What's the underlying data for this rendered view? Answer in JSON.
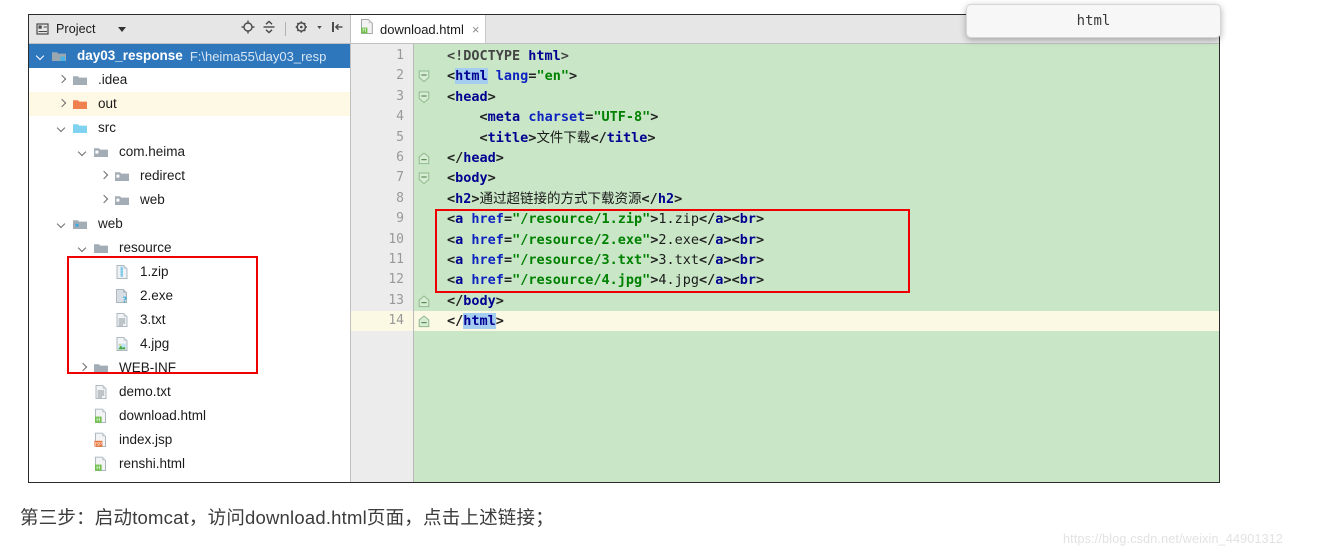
{
  "project_panel": {
    "title": "Project",
    "icons": [
      "project-view-icon",
      "chevron-down-icon",
      "locate-target-icon",
      "collapse-all-icon",
      "settings-gear-icon",
      "hide-panel-icon"
    ],
    "tree": [
      {
        "depth": 0,
        "arrow": "down",
        "icon": "module-folder-icon",
        "label": "day03_response",
        "path": "F:\\heima55\\day03_resp",
        "state": "selected",
        "bold": true
      },
      {
        "depth": 1,
        "arrow": "right",
        "icon": "folder-gray-icon",
        "label": ".idea",
        "path": "",
        "state": "normal",
        "bold": false
      },
      {
        "depth": 1,
        "arrow": "right",
        "icon": "folder-orange-icon",
        "label": "out",
        "path": "",
        "state": "excluded",
        "bold": false
      },
      {
        "depth": 1,
        "arrow": "down",
        "icon": "folder-source-icon",
        "label": "src",
        "path": "",
        "state": "normal",
        "bold": false
      },
      {
        "depth": 2,
        "arrow": "down",
        "icon": "package-icon",
        "label": "com.heima",
        "path": "",
        "state": "normal",
        "bold": false
      },
      {
        "depth": 3,
        "arrow": "right",
        "icon": "package-icon",
        "label": "redirect",
        "path": "",
        "state": "normal",
        "bold": false
      },
      {
        "depth": 3,
        "arrow": "right",
        "icon": "package-icon",
        "label": "web",
        "path": "",
        "state": "normal",
        "bold": false
      },
      {
        "depth": 1,
        "arrow": "down",
        "icon": "folder-web-icon",
        "label": "web",
        "path": "",
        "state": "normal",
        "bold": false
      },
      {
        "depth": 2,
        "arrow": "down",
        "icon": "folder-gray-icon",
        "label": "resource",
        "path": "",
        "state": "normal",
        "bold": false
      },
      {
        "depth": 3,
        "arrow": "none",
        "icon": "zip-file-icon",
        "label": "1.zip",
        "path": "",
        "state": "normal",
        "bold": false
      },
      {
        "depth": 3,
        "arrow": "none",
        "icon": "exe-file-icon",
        "label": "2.exe",
        "path": "",
        "state": "normal",
        "bold": false
      },
      {
        "depth": 3,
        "arrow": "none",
        "icon": "text-file-icon",
        "label": "3.txt",
        "path": "",
        "state": "normal",
        "bold": false
      },
      {
        "depth": 3,
        "arrow": "none",
        "icon": "image-file-icon",
        "label": "4.jpg",
        "path": "",
        "state": "normal",
        "bold": false
      },
      {
        "depth": 2,
        "arrow": "right",
        "icon": "folder-gray-icon",
        "label": "WEB-INF",
        "path": "",
        "state": "normal",
        "bold": false
      },
      {
        "depth": 2,
        "arrow": "none",
        "icon": "text-file-icon",
        "label": "demo.txt",
        "path": "",
        "state": "normal",
        "bold": false
      },
      {
        "depth": 2,
        "arrow": "none",
        "icon": "html-file-icon",
        "label": "download.html",
        "path": "",
        "state": "normal",
        "bold": false
      },
      {
        "depth": 2,
        "arrow": "none",
        "icon": "jsp-file-icon",
        "label": "index.jsp",
        "path": "",
        "state": "normal",
        "bold": false
      },
      {
        "depth": 2,
        "arrow": "none",
        "icon": "html-file-icon",
        "label": "renshi.html",
        "path": "",
        "state": "normal",
        "bold": false
      }
    ]
  },
  "editor": {
    "tab": {
      "label": "download.html",
      "icon": "html-file-icon",
      "close": "×"
    },
    "current_line": 14,
    "lines": [
      {
        "n": "1",
        "indent": 0,
        "fold": "none",
        "tokens": [
          {
            "t": "doc",
            "v": "<!DOCTYPE "
          },
          {
            "t": "tag",
            "v": "html"
          },
          {
            "t": "doc",
            "v": ">"
          }
        ]
      },
      {
        "n": "2",
        "indent": 0,
        "fold": "open",
        "tokens": [
          {
            "t": "punct",
            "v": "<"
          },
          {
            "t": "tag",
            "v": "html",
            "sel": true
          },
          {
            "t": "punct",
            "v": " "
          },
          {
            "t": "attr",
            "v": "lang"
          },
          {
            "t": "punct",
            "v": "="
          },
          {
            "t": "val",
            "v": "\"en\""
          },
          {
            "t": "punct",
            "v": ">"
          }
        ]
      },
      {
        "n": "3",
        "indent": 0,
        "fold": "open",
        "tokens": [
          {
            "t": "punct",
            "v": "<"
          },
          {
            "t": "tag",
            "v": "head"
          },
          {
            "t": "punct",
            "v": ">"
          }
        ]
      },
      {
        "n": "4",
        "indent": 1,
        "fold": "none",
        "tokens": [
          {
            "t": "punct",
            "v": "<"
          },
          {
            "t": "tag",
            "v": "meta"
          },
          {
            "t": "punct",
            "v": " "
          },
          {
            "t": "attr",
            "v": "charset"
          },
          {
            "t": "punct",
            "v": "="
          },
          {
            "t": "val",
            "v": "\"UTF-8\""
          },
          {
            "t": "punct",
            "v": ">"
          }
        ]
      },
      {
        "n": "5",
        "indent": 1,
        "fold": "none",
        "tokens": [
          {
            "t": "punct",
            "v": "<"
          },
          {
            "t": "tag",
            "v": "title"
          },
          {
            "t": "punct",
            "v": ">"
          },
          {
            "t": "text",
            "v": "文件下载"
          },
          {
            "t": "punct",
            "v": "</"
          },
          {
            "t": "tag",
            "v": "title"
          },
          {
            "t": "punct",
            "v": ">"
          }
        ]
      },
      {
        "n": "6",
        "indent": 0,
        "fold": "close",
        "tokens": [
          {
            "t": "punct",
            "v": "</"
          },
          {
            "t": "tag",
            "v": "head"
          },
          {
            "t": "punct",
            "v": ">"
          }
        ]
      },
      {
        "n": "7",
        "indent": 0,
        "fold": "open",
        "tokens": [
          {
            "t": "punct",
            "v": "<"
          },
          {
            "t": "tag",
            "v": "body"
          },
          {
            "t": "punct",
            "v": ">"
          }
        ]
      },
      {
        "n": "8",
        "indent": 0,
        "fold": "none",
        "tokens": [
          {
            "t": "punct",
            "v": "<"
          },
          {
            "t": "tag",
            "v": "h2"
          },
          {
            "t": "punct",
            "v": ">"
          },
          {
            "t": "text",
            "v": "通过超链接的方式下载资源"
          },
          {
            "t": "punct",
            "v": "</"
          },
          {
            "t": "tag",
            "v": "h2"
          },
          {
            "t": "punct",
            "v": ">"
          }
        ]
      },
      {
        "n": "9",
        "indent": 0,
        "fold": "none",
        "tokens": [
          {
            "t": "punct",
            "v": "<"
          },
          {
            "t": "tag",
            "v": "a"
          },
          {
            "t": "punct",
            "v": " "
          },
          {
            "t": "attr",
            "v": "href"
          },
          {
            "t": "punct",
            "v": "="
          },
          {
            "t": "val",
            "v": "\"/resource/1.zip\""
          },
          {
            "t": "punct",
            "v": ">"
          },
          {
            "t": "text",
            "v": "1.zip"
          },
          {
            "t": "punct",
            "v": "</"
          },
          {
            "t": "tag",
            "v": "a"
          },
          {
            "t": "punct",
            "v": "><"
          },
          {
            "t": "tag",
            "v": "br"
          },
          {
            "t": "punct",
            "v": ">"
          }
        ]
      },
      {
        "n": "10",
        "indent": 0,
        "fold": "none",
        "tokens": [
          {
            "t": "punct",
            "v": "<"
          },
          {
            "t": "tag",
            "v": "a"
          },
          {
            "t": "punct",
            "v": " "
          },
          {
            "t": "attr",
            "v": "href"
          },
          {
            "t": "punct",
            "v": "="
          },
          {
            "t": "val",
            "v": "\"/resource/2.exe\""
          },
          {
            "t": "punct",
            "v": ">"
          },
          {
            "t": "text",
            "v": "2.exe"
          },
          {
            "t": "punct",
            "v": "</"
          },
          {
            "t": "tag",
            "v": "a"
          },
          {
            "t": "punct",
            "v": "><"
          },
          {
            "t": "tag",
            "v": "br"
          },
          {
            "t": "punct",
            "v": ">"
          }
        ]
      },
      {
        "n": "11",
        "indent": 0,
        "fold": "none",
        "tokens": [
          {
            "t": "punct",
            "v": "<"
          },
          {
            "t": "tag",
            "v": "a"
          },
          {
            "t": "punct",
            "v": " "
          },
          {
            "t": "attr",
            "v": "href"
          },
          {
            "t": "punct",
            "v": "="
          },
          {
            "t": "val",
            "v": "\"/resource/3.txt\""
          },
          {
            "t": "punct",
            "v": ">"
          },
          {
            "t": "text",
            "v": "3.txt"
          },
          {
            "t": "punct",
            "v": "</"
          },
          {
            "t": "tag",
            "v": "a"
          },
          {
            "t": "punct",
            "v": "><"
          },
          {
            "t": "tag",
            "v": "br"
          },
          {
            "t": "punct",
            "v": ">"
          }
        ]
      },
      {
        "n": "12",
        "indent": 0,
        "fold": "none",
        "tokens": [
          {
            "t": "punct",
            "v": "<"
          },
          {
            "t": "tag",
            "v": "a"
          },
          {
            "t": "punct",
            "v": " "
          },
          {
            "t": "attr",
            "v": "href"
          },
          {
            "t": "punct",
            "v": "="
          },
          {
            "t": "val",
            "v": "\"/resource/4.jpg\""
          },
          {
            "t": "punct",
            "v": ">"
          },
          {
            "t": "text",
            "v": "4.jpg"
          },
          {
            "t": "punct",
            "v": "</"
          },
          {
            "t": "tag",
            "v": "a"
          },
          {
            "t": "punct",
            "v": "><"
          },
          {
            "t": "tag",
            "v": "br"
          },
          {
            "t": "punct",
            "v": ">"
          }
        ]
      },
      {
        "n": "13",
        "indent": 0,
        "fold": "close",
        "tokens": [
          {
            "t": "punct",
            "v": "</"
          },
          {
            "t": "tag",
            "v": "body"
          },
          {
            "t": "punct",
            "v": ">"
          }
        ]
      },
      {
        "n": "14",
        "indent": 0,
        "fold": "close",
        "tokens": [
          {
            "t": "punct",
            "v": "</"
          },
          {
            "t": "tag",
            "v": "html",
            "sel": true
          },
          {
            "t": "punct",
            "v": ">"
          }
        ]
      }
    ]
  },
  "tooltip": {
    "text": "html"
  },
  "annotations": {
    "resource_box": "red-highlight-box-resource-folder",
    "code_box": "red-highlight-box-anchor-lines"
  },
  "caption": "第三步：启动tomcat，访问download.html页面，点击上述链接；",
  "watermark": "https://blog.csdn.net/weixin_44901312",
  "colors": {
    "selection_blue": "#2f77bd",
    "editor_green": "#c9e7c7",
    "current_line": "#fbf8e3",
    "excluded_yellow": "#fdf9e4",
    "annotation_red": "#ef0000",
    "tag_blue": "#000091",
    "value_green": "#008000"
  }
}
